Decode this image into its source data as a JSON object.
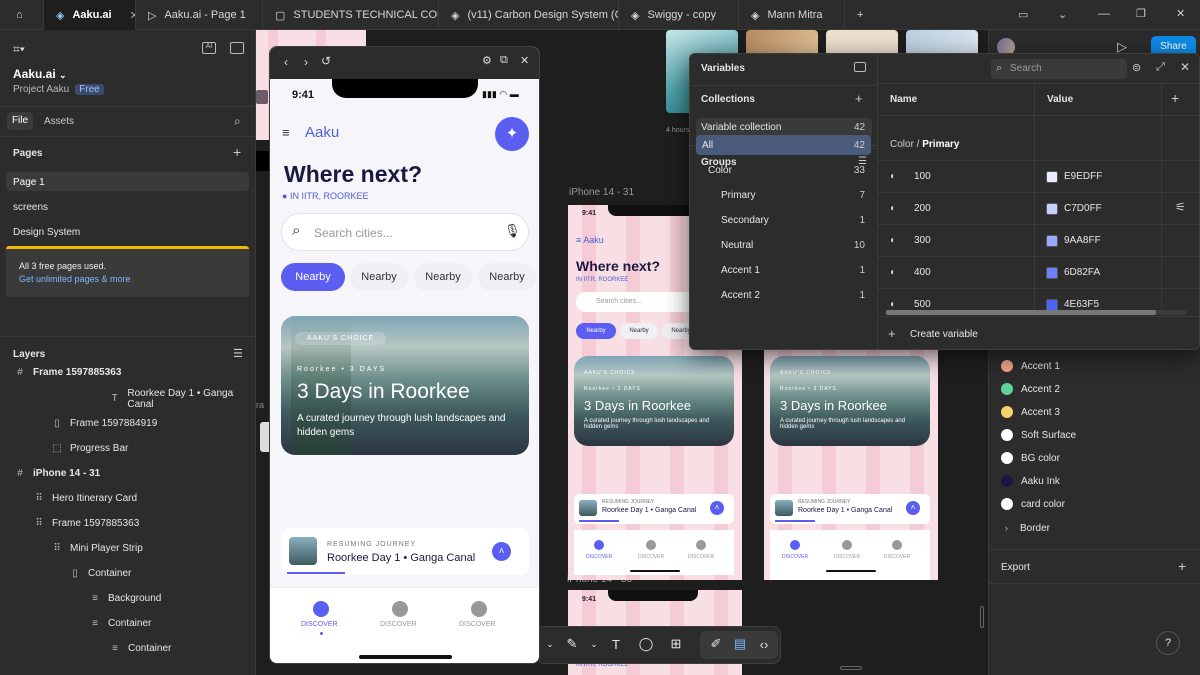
{
  "tabs": [
    {
      "label": "Aaku.ai"
    },
    {
      "label": "Aaku.ai - Page 1"
    },
    {
      "label": "STUDENTS TECHNICAL COUNCIL"
    },
    {
      "label": "(v11) Carbon Design System (Com"
    },
    {
      "label": "Swiggy - copy"
    },
    {
      "label": "Mann Mitra"
    }
  ],
  "project": {
    "name": "Aaku.ai",
    "sub": "Project Aaku",
    "plan": "Free"
  },
  "left_tabs": {
    "file": "File",
    "assets": "Assets"
  },
  "pages": {
    "title": "Pages",
    "items": [
      "Page 1",
      "screens",
      "Design System"
    ]
  },
  "banner": {
    "text": "All 3 free pages used.",
    "link": "Get unlimited pages & more"
  },
  "layers": {
    "title": "Layers",
    "items": [
      {
        "label": "Frame 1597885363",
        "icon": "#"
      },
      {
        "label": "Roorkee Day 1 • Ganga Canal",
        "icon": "T"
      },
      {
        "label": "Frame 1597884919",
        "icon": "▯"
      },
      {
        "label": "Progress Bar",
        "icon": "⬚"
      },
      {
        "label": "iPhone 14 - 31",
        "icon": "#"
      },
      {
        "label": "Hero Itinerary Card",
        "icon": "⠿"
      },
      {
        "label": "Frame 1597885363",
        "icon": "⠿"
      },
      {
        "label": "Mini Player Strip",
        "icon": "⠿"
      },
      {
        "label": "Container",
        "icon": "▯"
      },
      {
        "label": "Background",
        "icon": "≡"
      },
      {
        "label": "Container",
        "icon": "≡"
      },
      {
        "label": "Container",
        "icon": "≡"
      }
    ]
  },
  "phone": {
    "time": "9:41",
    "brand": "Aaku",
    "heading": "Where next?",
    "location": "IN IITR, ROORKEE",
    "search_placeholder": "Search cities...",
    "chips": [
      "Nearby",
      "Nearby",
      "Nearby",
      "Nearby"
    ],
    "hero": {
      "badge": "AAKU'S CHOICE",
      "meta": "Roorkee • 3 DAYS",
      "title": "3 Days in Roorkee",
      "desc": "A curated journey through lush landscapes and hidden gems"
    },
    "player": {
      "kicker": "RESUMING JOURNEY",
      "title": "Roorkee Day 1 • Ganga Canal"
    },
    "nav": [
      "DISCOVER",
      "DISCOVER",
      "DISCOVER"
    ]
  },
  "frame_labels": {
    "a": "iPhone 14 - 31",
    "b": "iPhone 14 - 33"
  },
  "thumb_label": "4 hours",
  "vars": {
    "title": "Variables",
    "collections": "Collections",
    "collection": {
      "name": "Variable collection",
      "count": "42"
    },
    "groups_title": "Groups",
    "groups": [
      {
        "name": "All",
        "count": "42"
      },
      {
        "name": "Color",
        "count": "33"
      },
      {
        "name": "Primary",
        "count": "7"
      },
      {
        "name": "Secondary",
        "count": "1"
      },
      {
        "name": "Neutral",
        "count": "10"
      },
      {
        "name": "Accent 1",
        "count": "1"
      },
      {
        "name": "Accent 2",
        "count": "1"
      }
    ],
    "search_placeholder": "Search",
    "col_name": "Name",
    "col_value": "Value",
    "path_a": "Color / ",
    "path_b": "Primary",
    "rows": [
      {
        "name": "100",
        "value": "E9EDFF",
        "color": "#E9EDFF"
      },
      {
        "name": "200",
        "value": "C7D0FF",
        "color": "#C7D0FF"
      },
      {
        "name": "300",
        "value": "9AA8FF",
        "color": "#9AA8FF"
      },
      {
        "name": "400",
        "value": "6D82FA",
        "color": "#6D82FA"
      },
      {
        "name": "500",
        "value": "4E63F5",
        "color": "#4E63F5"
      }
    ],
    "create": "Create variable"
  },
  "share": "Share",
  "styles": [
    {
      "label": "Accent 1",
      "color": "#f4a58a"
    },
    {
      "label": "Accent 2",
      "color": "#5fd39a"
    },
    {
      "label": "Accent 3",
      "color": "#f3d36b"
    },
    {
      "label": "Soft Surface",
      "color": "#ffffff"
    },
    {
      "label": "BG color",
      "color": "#ffffff"
    },
    {
      "label": "Aaku Ink",
      "color": "#1a1840"
    },
    {
      "label": "card color",
      "color": "#ffffff"
    }
  ],
  "border_label": "Border",
  "export_label": "Export",
  "accent": "#5b5ef0"
}
